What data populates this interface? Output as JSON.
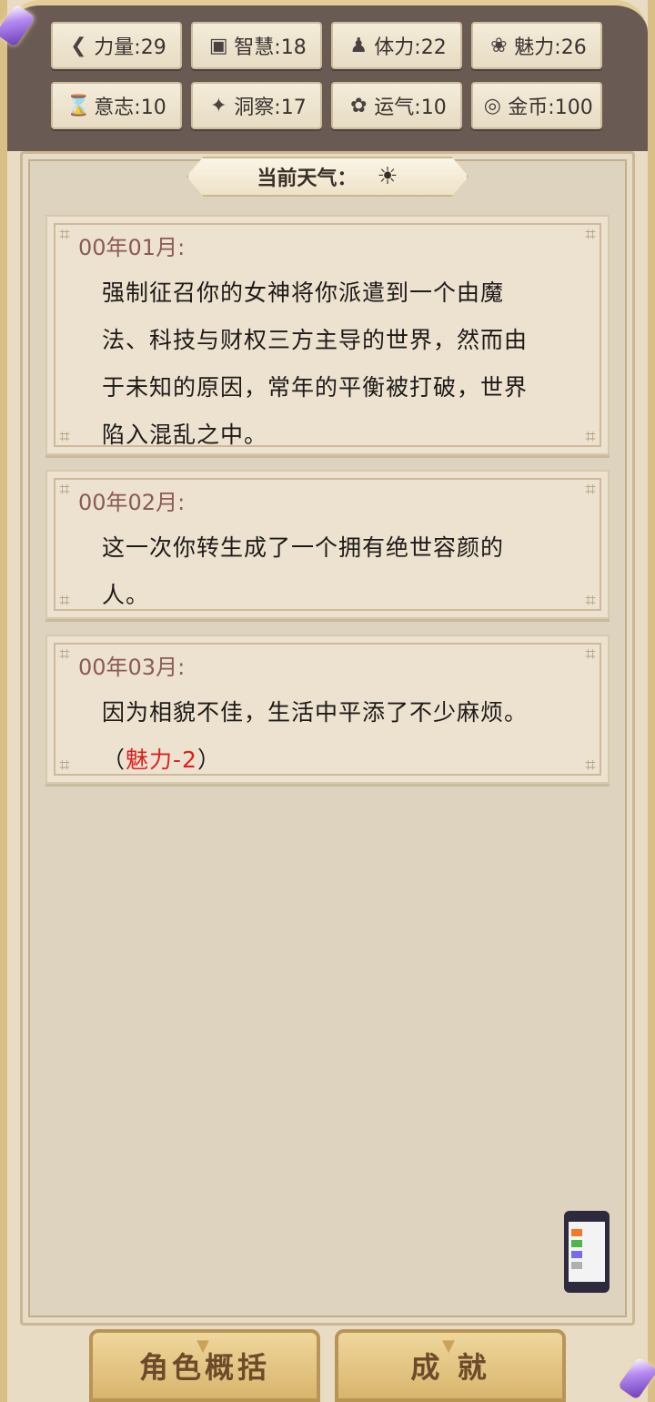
{
  "stats": [
    {
      "icon": "strength-icon",
      "glyph": "❮",
      "label": "力量:29"
    },
    {
      "icon": "wisdom-icon",
      "glyph": "▣",
      "label": "智慧:18"
    },
    {
      "icon": "stamina-icon",
      "glyph": "♟",
      "label": "体力:22"
    },
    {
      "icon": "charm-icon",
      "glyph": "❀",
      "label": "魅力:26"
    },
    {
      "icon": "will-icon",
      "glyph": "⌛",
      "label": "意志:10"
    },
    {
      "icon": "insight-icon",
      "glyph": "✦",
      "label": "洞察:17"
    },
    {
      "icon": "luck-icon",
      "glyph": "✿",
      "label": "运气:10"
    },
    {
      "icon": "coin-icon",
      "glyph": "◎",
      "label": "金币:100"
    }
  ],
  "weather": {
    "label": "当前天气：",
    "icon": "sun-icon",
    "glyph": "☀"
  },
  "entries": [
    {
      "date": "00年01月:",
      "text": "强制征召你的女神将你派遣到一个由魔法、科技与财权三方主导的世界，然而由于未知的原因，常年的平衡被打破，世界陷入混乱之中。",
      "effect": ""
    },
    {
      "date": "00年02月:",
      "text": "这一次你转生成了一个拥有绝世容颜的人。",
      "effect": ""
    },
    {
      "date": "00年03月:",
      "text": "因为相貌不佳，生活中平添了不少麻烦。（",
      "effect": "魅力-2",
      "after": "）"
    }
  ],
  "buttons": {
    "summary": "角色概括",
    "achievement": "成 就"
  },
  "colors": {
    "highlight": "#e01e1e",
    "frame_gold": "#d8bf86",
    "band": "#6a5a54"
  }
}
